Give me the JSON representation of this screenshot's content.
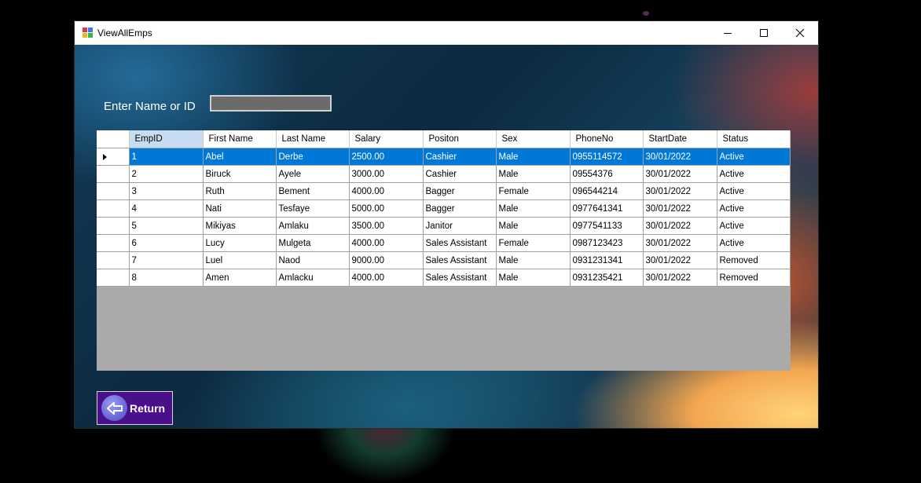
{
  "window": {
    "title": "ViewAllEmps"
  },
  "search": {
    "label": "Enter Name or ID",
    "value": ""
  },
  "table": {
    "columns": [
      "EmpID",
      "First Name",
      "Last Name",
      "Salary",
      "Positon",
      "Sex",
      "PhoneNo",
      "StartDate",
      "Status"
    ],
    "rows": [
      [
        "1",
        "Abel",
        "Derbe",
        "2500.00",
        "Cashier",
        "Male",
        "0955114572",
        "30/01/2022",
        "Active"
      ],
      [
        "2",
        "Biruck",
        "Ayele",
        "3000.00",
        "Cashier",
        "Male",
        "09554376",
        "30/01/2022",
        "Active"
      ],
      [
        "3",
        "Ruth",
        "Bement",
        "4000.00",
        "Bagger",
        "Female",
        "096544214",
        "30/01/2022",
        "Active"
      ],
      [
        "4",
        "Nati",
        "Tesfaye",
        "5000.00",
        "Bagger",
        "Male",
        "0977641341",
        "30/01/2022",
        "Active"
      ],
      [
        "5",
        "Mikiyas",
        "Amlaku",
        "3500.00",
        "Janitor",
        "Male",
        "0977541133",
        "30/01/2022",
        "Active"
      ],
      [
        "6",
        "Lucy",
        "Mulgeta",
        "4000.00",
        "Sales Assistant",
        "Female",
        "0987123423",
        "30/01/2022",
        "Active"
      ],
      [
        "7",
        "Luel",
        "Naod",
        "9000.00",
        "Sales Assistant",
        "Male",
        "0931231341",
        "30/01/2022",
        "Removed"
      ],
      [
        "8",
        "Amen",
        "Amlacku",
        "4000.00",
        "Sales Assistant",
        "Male",
        "0931235421",
        "30/01/2022",
        "Removed"
      ]
    ],
    "selected_row": 0
  },
  "return_button": {
    "label": "Return"
  },
  "colors": {
    "selection": "#0078d7",
    "button_bg": "#4a0f8a",
    "grid_bg": "#aaaaaa"
  }
}
